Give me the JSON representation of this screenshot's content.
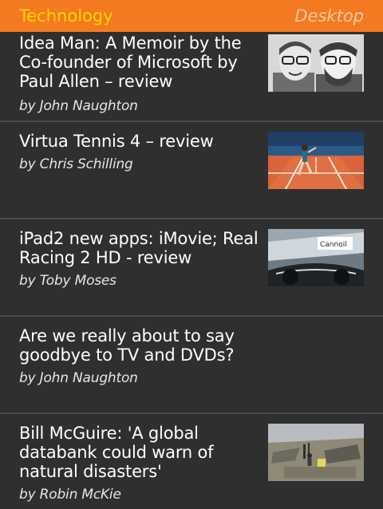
{
  "header": {
    "section": "Technology",
    "desktop_label": "Desktop"
  },
  "articles": [
    {
      "headline": "Idea Man: A Memoir by the Co-founder of Microsoft by Paul Allen – review",
      "byline": "by John Naughton",
      "thumbnail": "two-men-black-white-photo"
    },
    {
      "headline": "Virtua Tennis 4 – review",
      "byline": "by Chris Schilling",
      "thumbnail": "tennis-clay-court"
    },
    {
      "headline": "iPad2 new apps: iMovie; Real Racing 2 HD - review",
      "byline": "by Toby Moses",
      "thumbnail": "racing-car-cockpit"
    },
    {
      "headline": "Are we really about to say goodbye to TV and DVDs?",
      "byline": "by John Naughton",
      "thumbnail": null
    },
    {
      "headline": "Bill McGuire: 'A global databank could warn of natural disasters'",
      "byline": "by Robin McKie",
      "thumbnail": "disaster-debris-scene"
    }
  ],
  "colors": {
    "header_bg": "#f47a21",
    "section_title": "#ffd400",
    "desktop_link": "#f9c9a4",
    "page_bg": "#2f2f2f",
    "divider": "#4a4a4a"
  }
}
